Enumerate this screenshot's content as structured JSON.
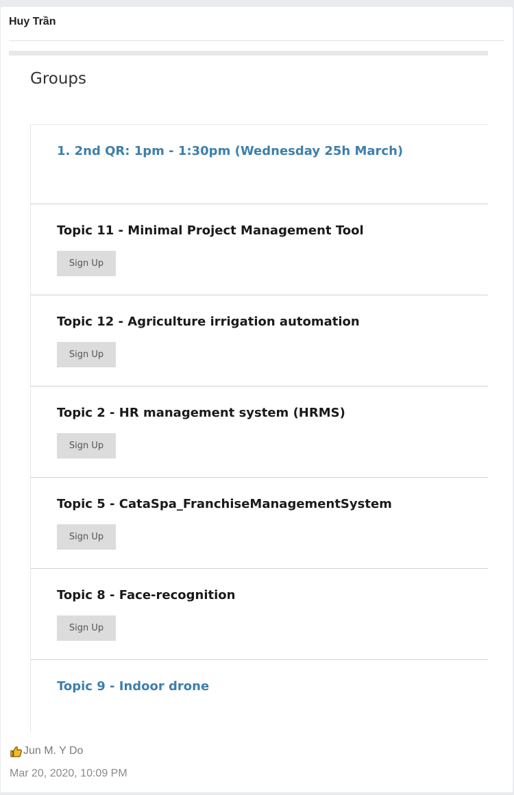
{
  "post": {
    "author": "Huy Trần",
    "reaction_user": "Jun M. Y Do",
    "timestamp": "Mar 20, 2020, 10:09 PM"
  },
  "embed": {
    "heading": "Groups",
    "group_title": "1. 2nd QR: 1pm - 1:30pm (Wednesday 25h March)",
    "topics": [
      {
        "title": "Topic 11 - Minimal Project Management Tool",
        "button": "Sign Up"
      },
      {
        "title": "Topic 12 - Agriculture irrigation automation",
        "button": "Sign Up"
      },
      {
        "title": "Topic 2 - HR management system (HRMS)",
        "button": "Sign Up"
      },
      {
        "title": "Topic 5 - CataSpa_FranchiseManagementSystem",
        "button": "Sign Up"
      },
      {
        "title": "Topic 8 - Face-recognition",
        "button": "Sign Up"
      },
      {
        "title": "Topic 9 - Indoor drone"
      }
    ]
  },
  "colors": {
    "link": "#3d7fac",
    "button_bg": "#dcdcdc",
    "reaction_icon": "#f7b928"
  },
  "icons": {
    "reaction": "thumbs-up-icon"
  }
}
